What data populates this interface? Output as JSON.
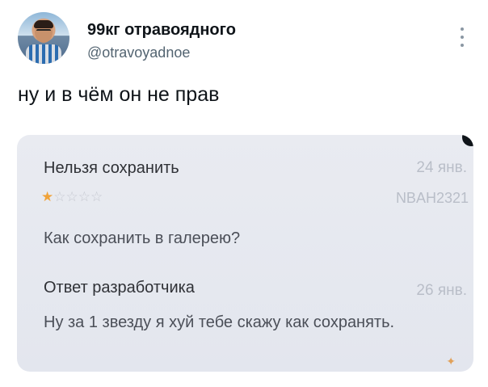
{
  "tweet": {
    "author_name": "99кг отравоядного",
    "author_handle": "@otravoyadnoe",
    "text": "ну и в чём он не прав"
  },
  "review": {
    "title": "Нельзя сохранить",
    "date": "24 янв.",
    "rating": 1,
    "rating_max": 5,
    "user": "NBAH2321",
    "body": "Как сохранить в галерею?"
  },
  "developer_reply": {
    "title": "Ответ разработчика",
    "date": "26 янв.",
    "body": "Ну за 1 звезду я хуй тебе скажу как сохранять."
  },
  "icons": {
    "more": "more-vertical-icon",
    "star": "star-icon"
  },
  "colors": {
    "star_filled": "#f0a33a",
    "star_empty": "#c7cad1",
    "card_bg": "#e6e9f0"
  }
}
